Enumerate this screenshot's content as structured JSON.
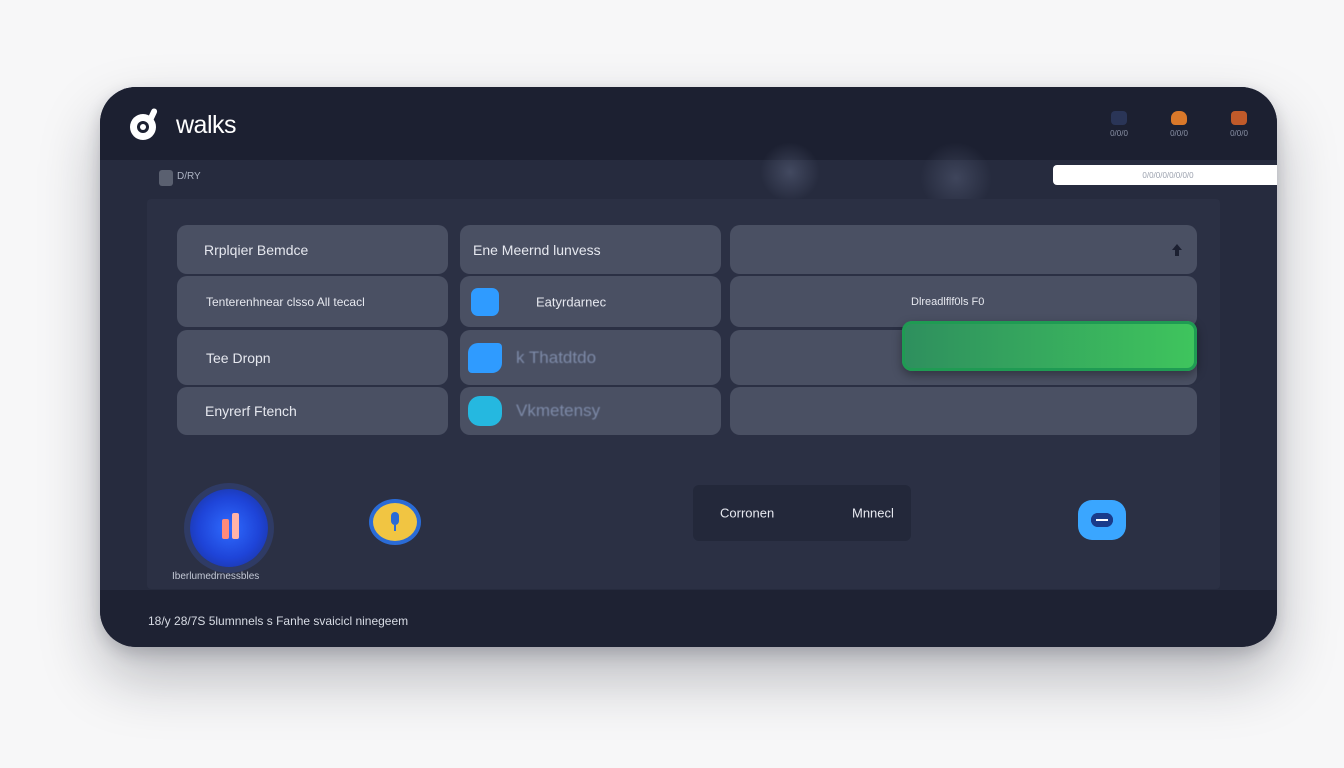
{
  "app": {
    "brand": "walks"
  },
  "header": {
    "icons": [
      {
        "name": "play-icon",
        "label": "0/0/0",
        "color": "#2a3557"
      },
      {
        "name": "burger-icon",
        "label": "0/0/0",
        "color": "#d9782a"
      },
      {
        "name": "box-icon",
        "label": "0/0/0",
        "color": "#c05a2a"
      }
    ]
  },
  "subbar": {
    "label": "D/RY",
    "search_placeholder": "0/0/0/0/0/0/0/0"
  },
  "grid": {
    "col1": [
      "Rrplqier Bemdce",
      "Tenterenhnear clsso All tecacl",
      "Tee Dropn",
      "Enyrerf Ftench"
    ],
    "col2": [
      {
        "label": "Ene Meernd lunvess",
        "icon": null
      },
      {
        "label": "Eatyrdarnec",
        "icon": "grid-icon",
        "icon_color": "#2f9bff"
      },
      {
        "label": "k Thatdtdo",
        "icon": "link-icon",
        "icon_color": "#2f9bff"
      },
      {
        "label": "Vkmetensy",
        "icon": "hook-icon",
        "icon_color": "#25b8e0"
      }
    ],
    "col3": [
      {
        "label": ""
      },
      {
        "label": "Dlreadlflf0ls F0"
      },
      {
        "label": ""
      },
      {
        "label": ""
      }
    ]
  },
  "progress": {
    "fill": 1.0,
    "color": "#3fc55d"
  },
  "bottom": {
    "orb_label": "Iberlumedrnessbles",
    "segment": [
      "Corronen",
      "Mnnecl"
    ]
  },
  "footer": {
    "text": "18/y 28/7S 5lumnnels s Fanhe svaicicl ninegeem"
  }
}
